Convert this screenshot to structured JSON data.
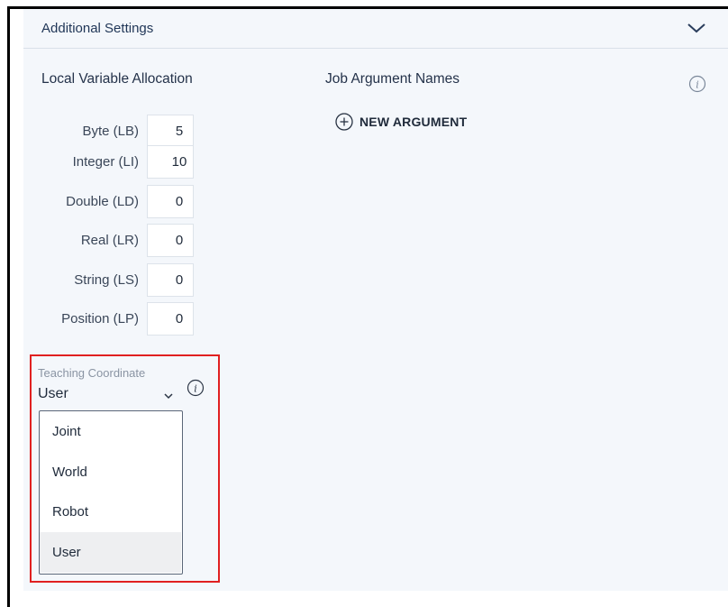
{
  "header": {
    "title": "Additional Settings",
    "collapse_icon": "chevron-down-icon"
  },
  "local_variables": {
    "title": "Local Variable Allocation",
    "items": [
      {
        "label": "Byte (LB)",
        "value": "5"
      },
      {
        "label": "Integer (LI)",
        "value": "10"
      },
      {
        "label": "Double (LD)",
        "value": "0"
      },
      {
        "label": "Real (LR)",
        "value": "0"
      },
      {
        "label": "String (LS)",
        "value": "0"
      },
      {
        "label": "Position (LP)",
        "value": "0"
      }
    ]
  },
  "job_arguments": {
    "title": "Job Argument Names",
    "info_icon": "info-icon",
    "new_argument_label": "NEW ARGUMENT",
    "new_argument_icon": "plus-circle-icon"
  },
  "teaching_coordinate": {
    "label": "Teaching Coordinate",
    "selected": "User",
    "info_icon": "info-icon",
    "options": [
      "Joint",
      "World",
      "Robot",
      "User"
    ]
  },
  "colors": {
    "panel_bg": "#f4f7fb",
    "highlight_border": "#e02020",
    "text_dark": "#1f2a3a"
  }
}
